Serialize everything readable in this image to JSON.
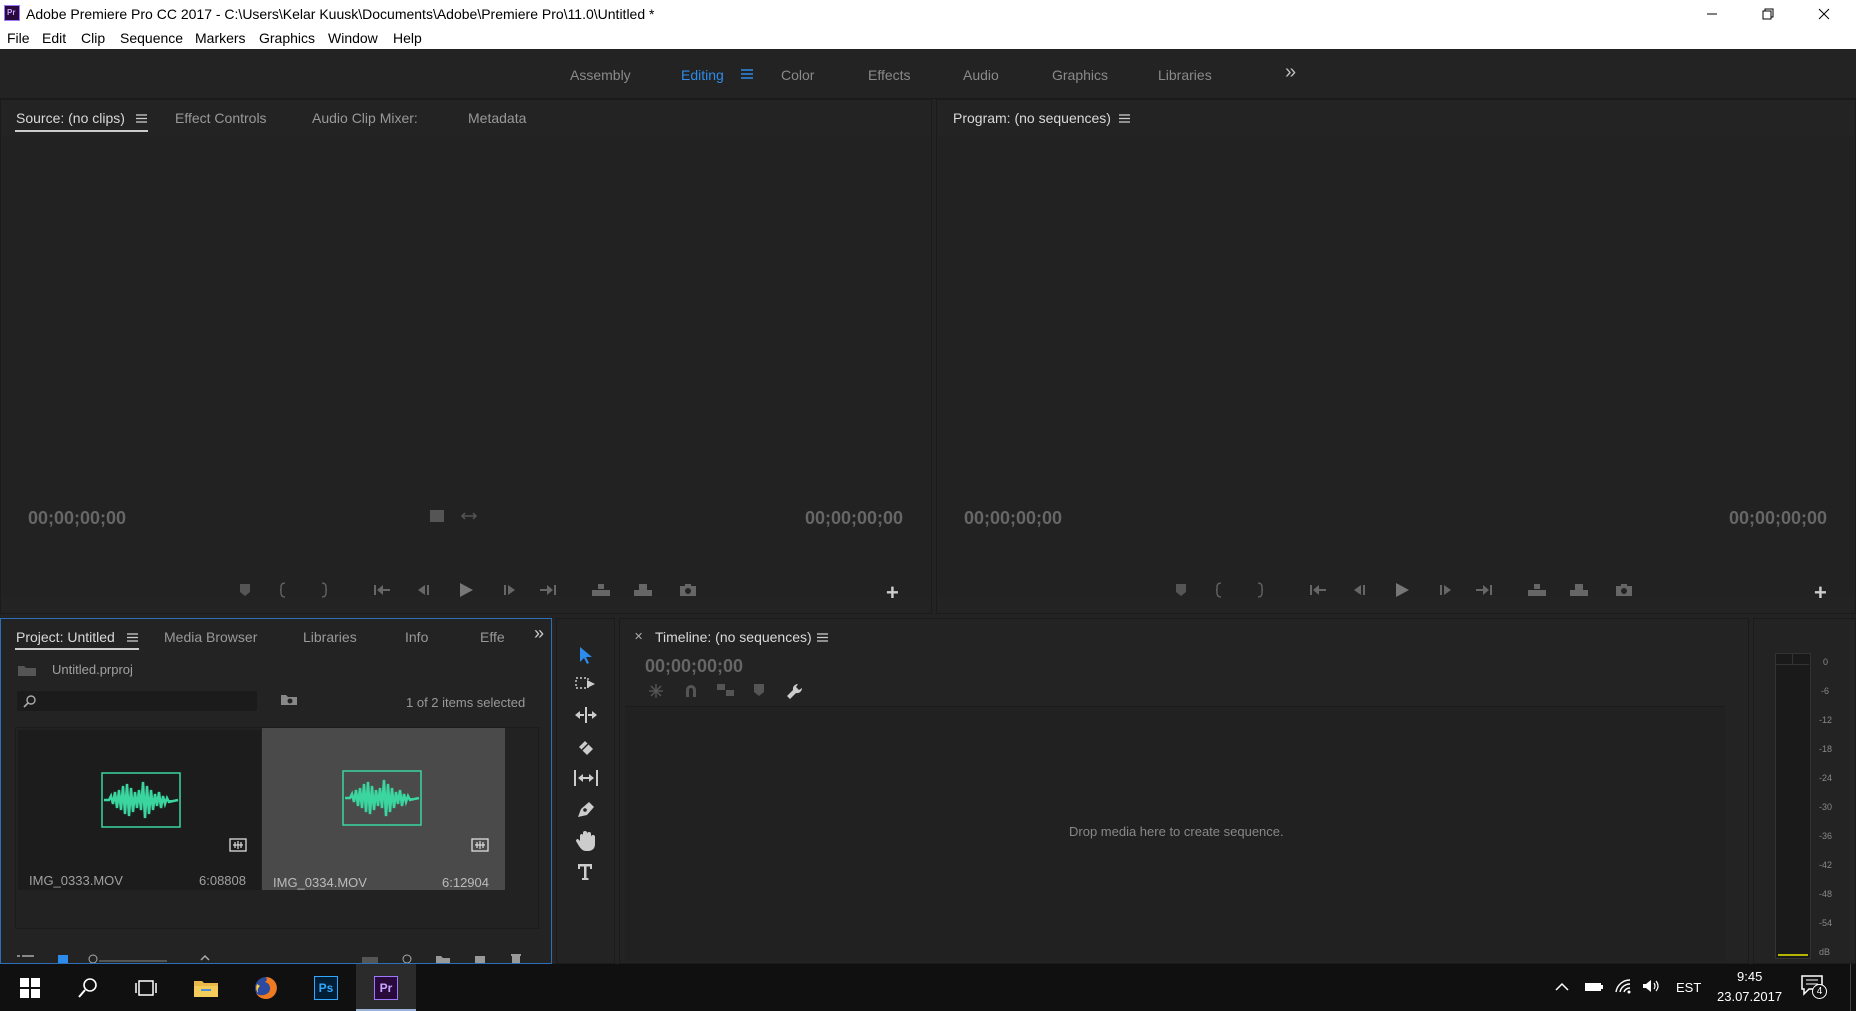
{
  "window": {
    "title": "Adobe Premiere Pro CC 2017 - C:\\Users\\Kelar Kuusk\\Documents\\Adobe\\Premiere Pro\\11.0\\Untitled *",
    "app_icon_label": "Pr"
  },
  "menu": [
    "File",
    "Edit",
    "Clip",
    "Sequence",
    "Markers",
    "Graphics",
    "Window",
    "Help"
  ],
  "workspaces": {
    "tabs": [
      "Assembly",
      "Editing",
      "Color",
      "Effects",
      "Audio",
      "Graphics",
      "Libraries"
    ],
    "active": "Editing",
    "overflow": "»"
  },
  "source_panel": {
    "tabs": [
      "Source: (no clips)",
      "Effect Controls",
      "Audio Clip Mixer:",
      "Metadata"
    ],
    "timecode_left": "00;00;00;00",
    "timecode_right": "00;00;00;00"
  },
  "program_panel": {
    "tab": "Program: (no sequences)",
    "timecode_left": "00;00;00;00",
    "timecode_right": "00;00;00;00"
  },
  "project_panel": {
    "tabs": [
      "Project: Untitled",
      "Media Browser",
      "Libraries",
      "Info",
      "Effe"
    ],
    "project_file": "Untitled.prproj",
    "selection_info": "1 of 2 items selected",
    "search_placeholder": "",
    "items": [
      {
        "name": "IMG_0333.MOV",
        "duration": "6:08808",
        "selected": false
      },
      {
        "name": "IMG_0334.MOV",
        "duration": "6:12904",
        "selected": true
      }
    ]
  },
  "timeline_panel": {
    "tab": "Timeline: (no sequences)",
    "timecode": "00;00;00;00",
    "empty_message": "Drop media here to create sequence."
  },
  "audio_meter": {
    "scale": [
      "0",
      "-6",
      "-12",
      "-18",
      "-24",
      "-30",
      "-36",
      "-42",
      "-48",
      "-54",
      "dB"
    ]
  },
  "taskbar": {
    "apps": [
      "start",
      "search",
      "task-view",
      "file-explorer",
      "firefox",
      "photoshop",
      "premiere"
    ],
    "photoshop_label": "Ps",
    "premiere_label": "Pr",
    "language": "EST",
    "time": "9:45",
    "date": "23.07.2017",
    "notification_count": "4"
  },
  "colors": {
    "accent_blue": "#2d8ceb",
    "waveform_green": "#3bd6a0",
    "premiere_purple": "#9a7bff",
    "photoshop_blue": "#31a8ff"
  }
}
